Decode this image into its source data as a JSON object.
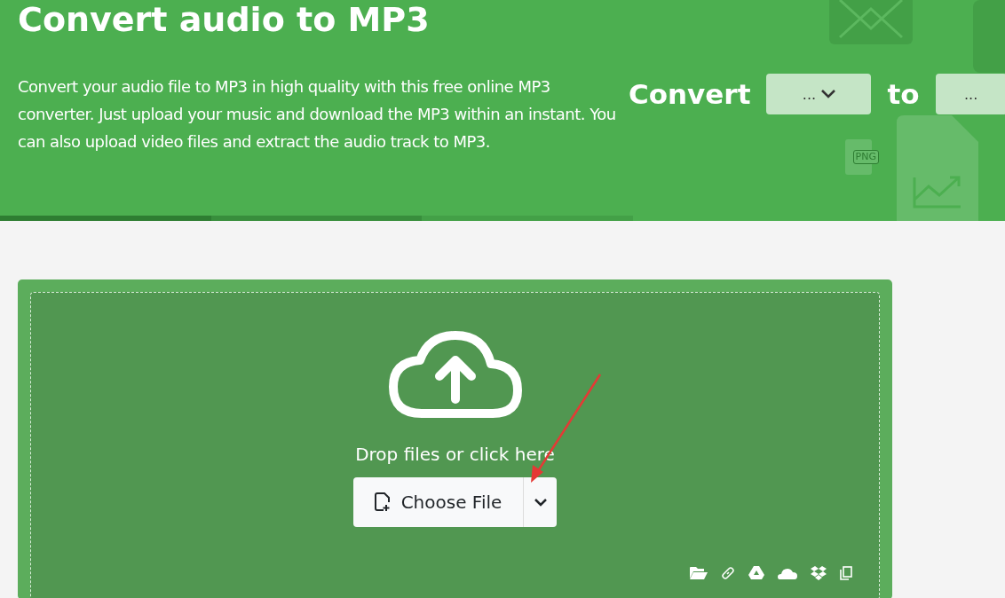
{
  "header": {
    "title": "Convert audio to MP3",
    "description": "Convert your audio file to MP3 in high quality with this free online MP3 converter. Just upload your music and download the MP3 within an instant. You can also upload video files and extract the audio track to MP3.",
    "convert_label": "Convert",
    "from_select": "...",
    "to_label": "to",
    "to_select": "...",
    "background_badges": [
      "PNG"
    ]
  },
  "upload": {
    "prompt": "Drop files or click here",
    "choose_button": "Choose File"
  }
}
